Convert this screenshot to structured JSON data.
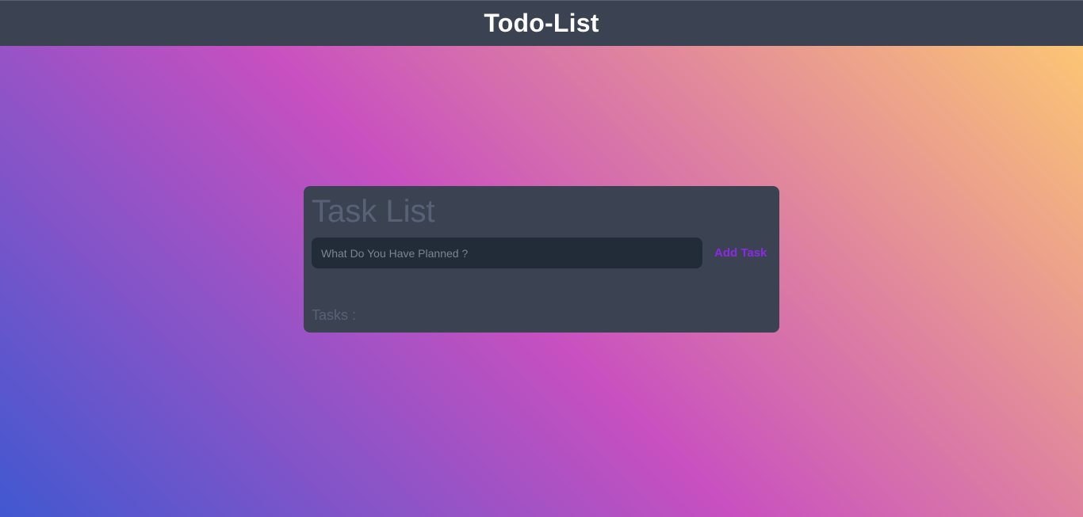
{
  "header": {
    "title": "Todo-List"
  },
  "card": {
    "title": "Task List",
    "input": {
      "placeholder": "What Do You Have Planned ?",
      "value": ""
    },
    "add_button_label": "Add Task",
    "tasks_label": "Tasks :"
  },
  "colors": {
    "header_bg": "#3b4252",
    "card_bg": "#3b4252",
    "input_bg": "#222b38",
    "accent": "#8a2be2",
    "muted_text": "#586277",
    "gradient": [
      "#4158D0",
      "#C850C0",
      "#FFCC70"
    ]
  }
}
